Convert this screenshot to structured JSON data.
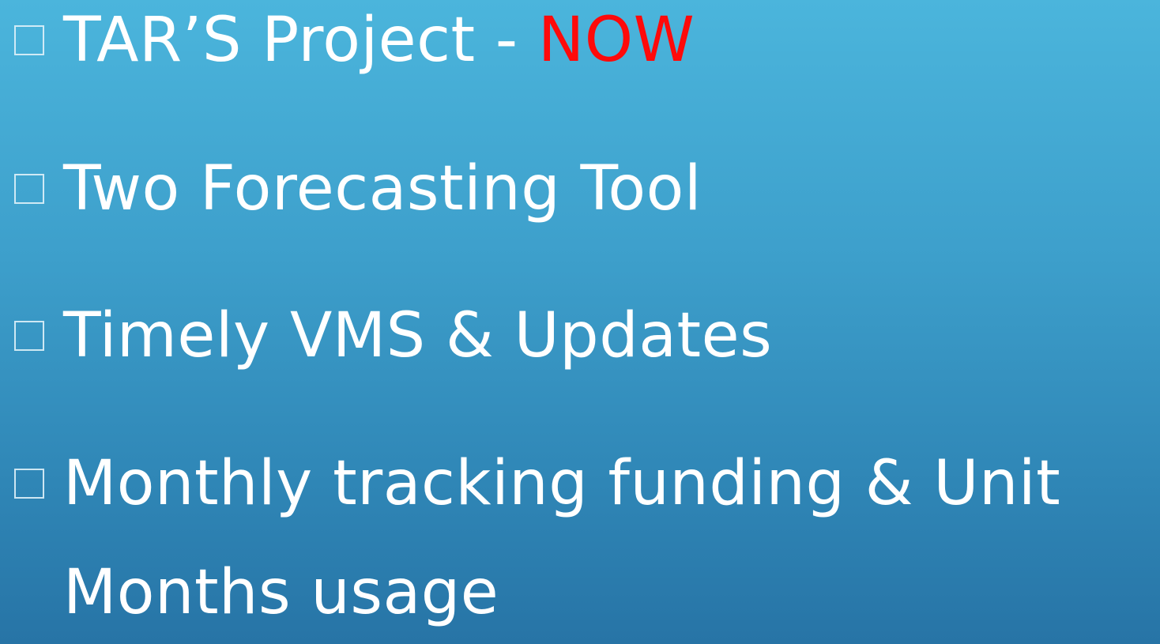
{
  "bullets": [
    {
      "text": "TAR’S Project - ",
      "highlight": "NOW"
    },
    {
      "text": "Two Forecasting Tool"
    },
    {
      "text": "Timely VMS & Updates"
    },
    {
      "text": "Monthly tracking funding & Unit",
      "continuation": "Months usage"
    }
  ],
  "colors": {
    "background_top": "#4bb5dc",
    "background_bottom": "#2774a6",
    "text": "#ffffff",
    "highlight": "#ff0a0a"
  },
  "icons": {
    "bullet": "square-bullet-icon"
  }
}
